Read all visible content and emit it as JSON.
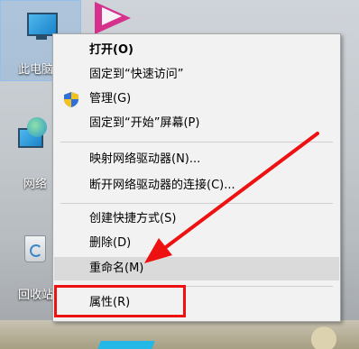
{
  "desktop": {
    "icons": [
      {
        "label": "此电脑"
      },
      {
        "label": "网络"
      },
      {
        "label": "回收站"
      }
    ]
  },
  "context_menu": {
    "items": [
      {
        "label": "打开(O)"
      },
      {
        "label": "固定到“快速访问”"
      },
      {
        "label": "管理(G)"
      },
      {
        "label": "固定到“开始”屏幕(P)"
      },
      {
        "label": "映射网络驱动器(N)..."
      },
      {
        "label": "断开网络驱动器的连接(C)..."
      },
      {
        "label": "创建快捷方式(S)"
      },
      {
        "label": "删除(D)"
      },
      {
        "label": "重命名(M)"
      },
      {
        "label": "属性(R)"
      }
    ]
  },
  "annotation": {
    "arrow_color": "#ee1111",
    "box_color": "#ee1111"
  }
}
